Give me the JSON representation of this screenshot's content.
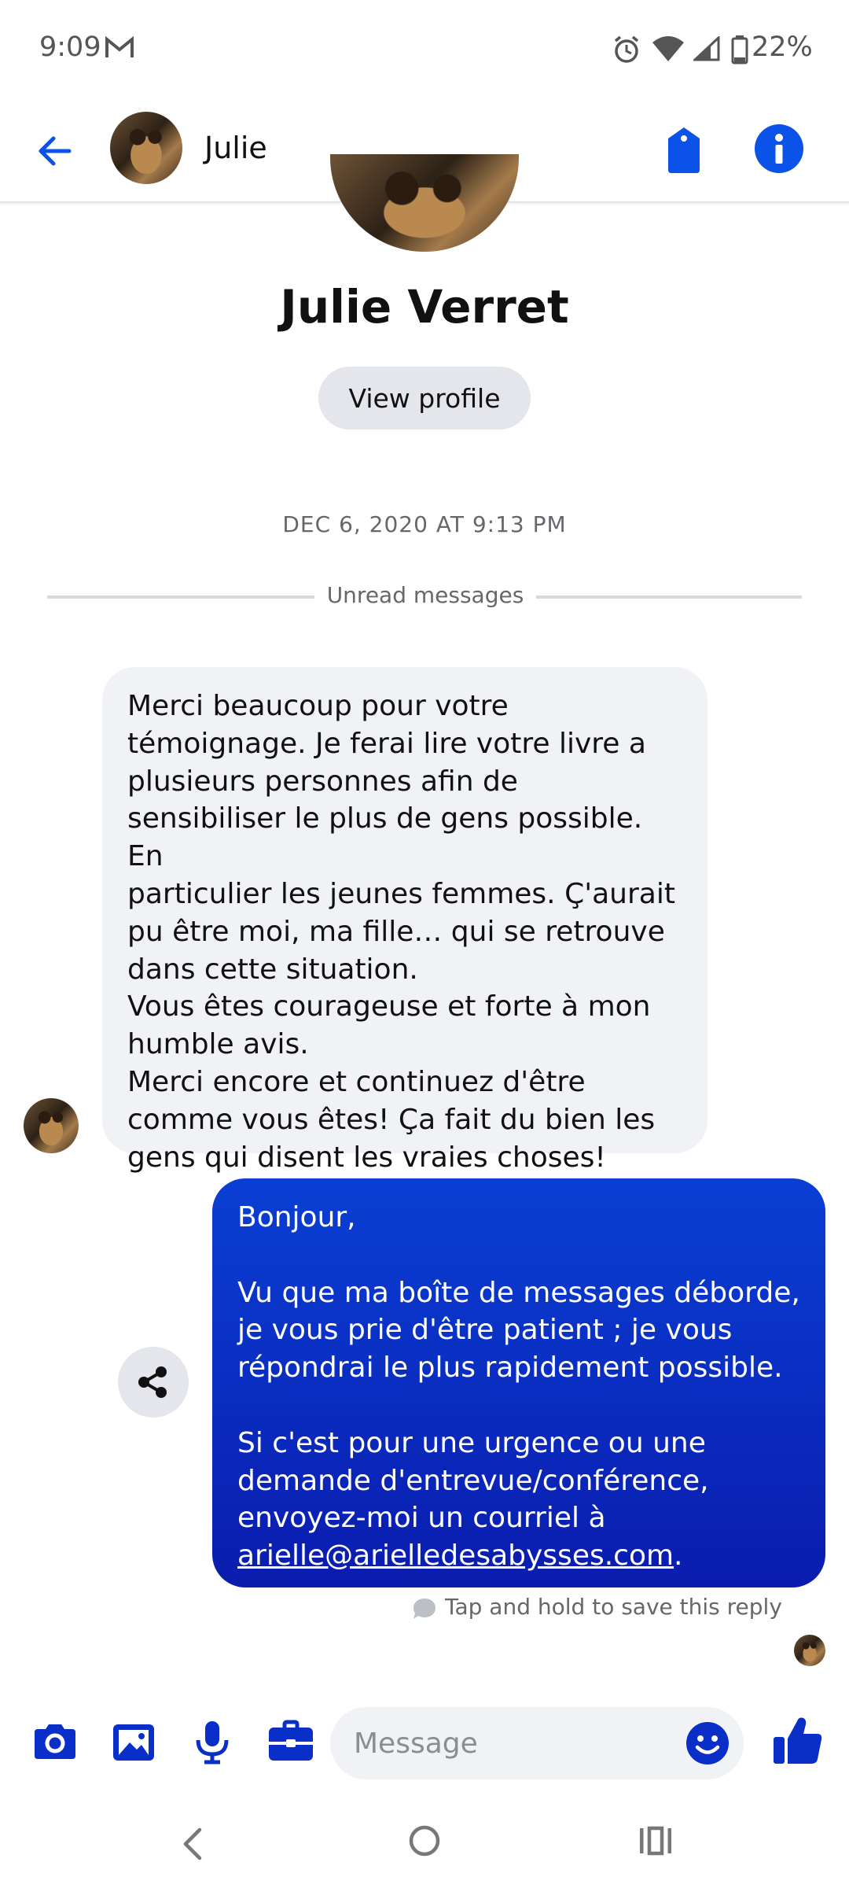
{
  "status_bar": {
    "time": "9:09",
    "battery_pct": "22%",
    "icons": [
      "gmail-icon",
      "alarm-icon",
      "wifi-icon",
      "signal-icon",
      "battery-icon"
    ]
  },
  "header": {
    "contact_short_name": "Julie",
    "icons": [
      "back-arrow-icon",
      "tag-icon",
      "info-icon"
    ]
  },
  "profile": {
    "full_name": "Julie Verret",
    "view_profile_label": "View profile"
  },
  "thread": {
    "date": "DEC 6, 2020 AT 9:13 PM",
    "unread_label": "Unread messages",
    "incoming_message": "Merci beaucoup pour votre\ntémoignage. Je ferai lire votre livre a\nplusieurs personnes afin de\nsensibiliser le plus de gens possible. En\nparticulier les jeunes femmes. Ç'aurait\npu être moi, ma fille… qui se retrouve\ndans cette situation.\nVous êtes courageuse et forte à mon\nhumble avis.\nMerci encore et continuez d'être\ncomme vous êtes!  Ça fait du bien les\ngens qui disent les vraies choses!",
    "outgoing_message_text": "Bonjour,\n\nVu que ma boîte de messages déborde,\nje vous prie d'être patient ; je vous\nrépondrai le plus rapidement possible.\n\nSi c'est pour une urgence ou une\ndemande d'entrevue/conférence,\nenvoyez-moi un courriel à\n",
    "outgoing_email": "arielle@arielledesabysses.com",
    "outgoing_end": ".",
    "save_hint": "Tap and hold to save this reply"
  },
  "composer": {
    "placeholder": "Message",
    "icons": [
      "camera-icon",
      "gallery-icon",
      "microphone-icon",
      "briefcase-icon",
      "emoji-icon",
      "thumbs-up-icon"
    ]
  },
  "colors": {
    "accent": "#0a52e8",
    "bubble_out_top": "#0a3fd4",
    "bubble_out_bottom": "#0a1cae",
    "bubble_in": "#f0f2f5"
  }
}
